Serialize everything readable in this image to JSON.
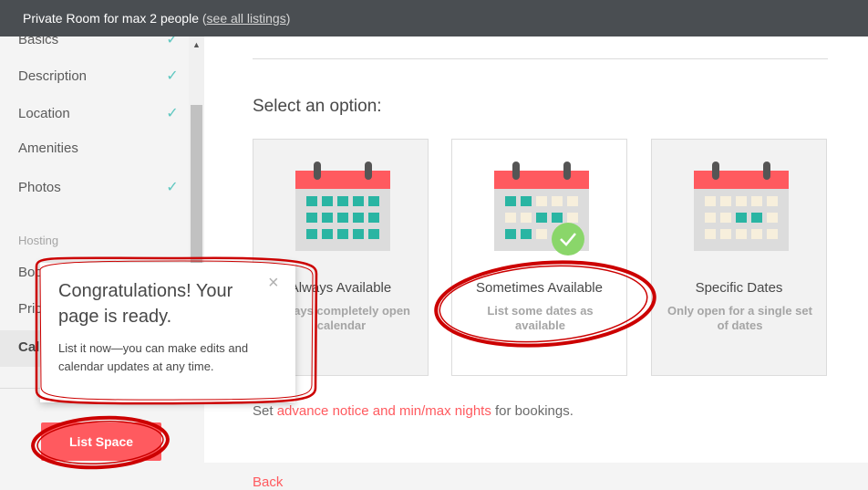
{
  "topbar": {
    "title": "Private Room for max 2 people",
    "see_all_listings": "see all listings"
  },
  "sidebar": {
    "items": [
      {
        "label": "Basics",
        "done": true
      },
      {
        "label": "Description",
        "done": true
      },
      {
        "label": "Location",
        "done": true
      },
      {
        "label": "Amenities",
        "done": false
      },
      {
        "label": "Photos",
        "done": true
      }
    ],
    "hosting_heading": "Hosting",
    "hosting_items": [
      {
        "label": "Boo"
      },
      {
        "label": "Pric"
      },
      {
        "label": "Cal"
      }
    ],
    "check_glyph": "✓"
  },
  "main": {
    "select_title": "Select an option:",
    "options": [
      {
        "title": "Always Available",
        "desc": "Always completely open calendar",
        "selected": false
      },
      {
        "title": "Sometimes Available",
        "desc": "List some dates as available",
        "selected": true
      },
      {
        "title": "Specific Dates",
        "desc": "Only open for a single set of dates",
        "selected": false
      }
    ],
    "notice_prefix": "Set",
    "notice_link": "advance notice and min/max nights",
    "notice_suffix": "for bookings.",
    "back_label": "Back"
  },
  "popover": {
    "title": "Congratulations! Your page is ready.",
    "body": "List it now—you can make edits and calendar updates at any time.",
    "close_glyph": "×"
  },
  "list_space_button": "List Space",
  "colors": {
    "accent": "#ff5a5f",
    "teal": "#2ab5a3",
    "check_green": "#8ad66a",
    "topbar": "#4a4e52",
    "annotation": "#cc0000"
  },
  "icons": {
    "calendar": "calendar-icon",
    "checkmark": "check-icon",
    "close": "close-icon"
  }
}
